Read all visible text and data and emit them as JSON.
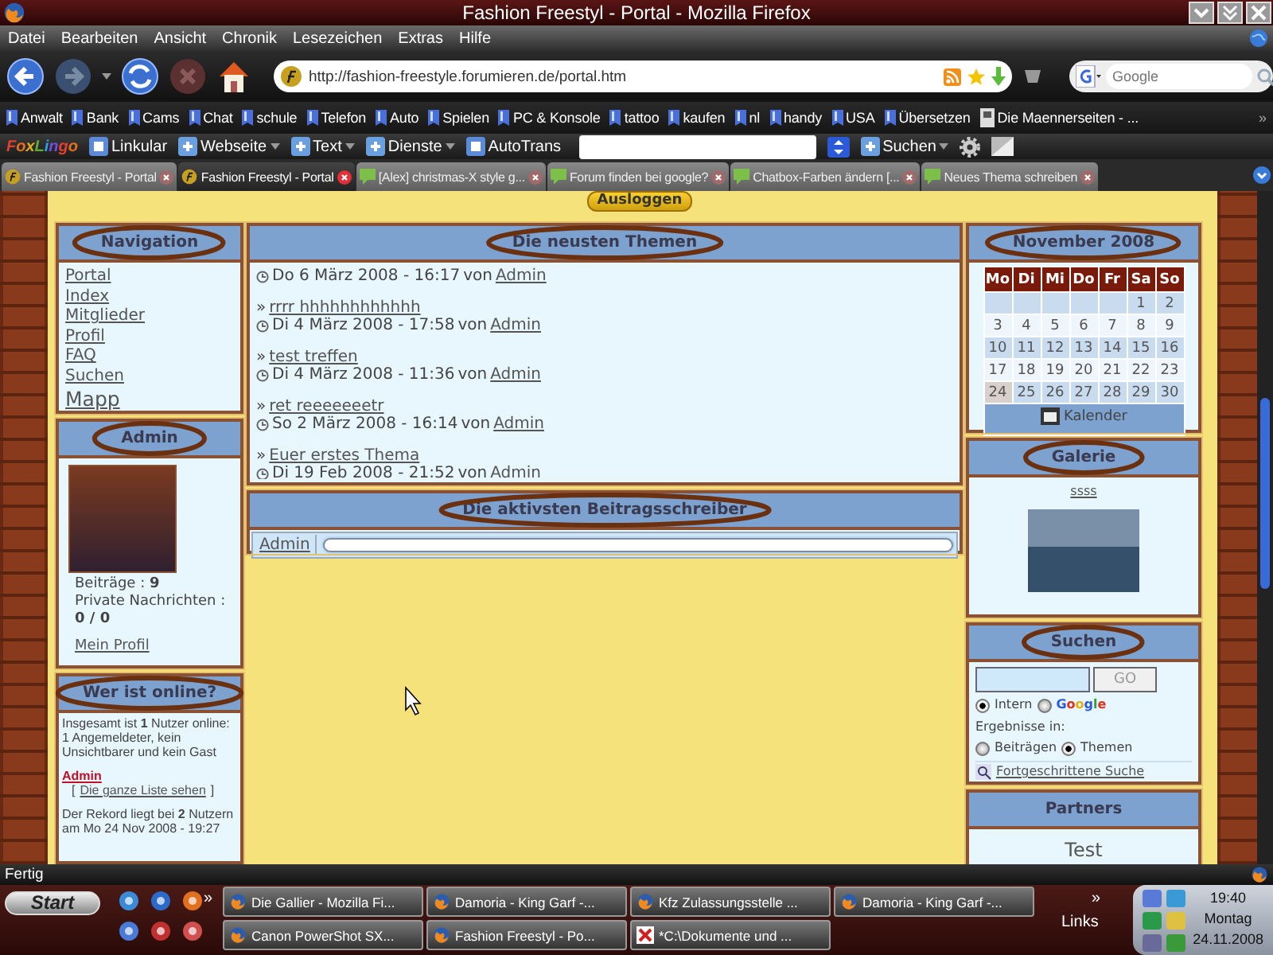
{
  "window": {
    "title": "Fashion Freestyl - Portal - Mozilla Firefox"
  },
  "menu": [
    "Datei",
    "Bearbeiten",
    "Ansicht",
    "Chronik",
    "Lesezeichen",
    "Extras",
    "Hilfe"
  ],
  "navigation_bar": {
    "url": "http://fashion-freestyle.forumieren.de/portal.htm",
    "search_placeholder": "Google"
  },
  "bookmarks": [
    "Anwalt",
    "Bank",
    "Cams",
    "Chat",
    "schule",
    "Telefon",
    "Auto",
    "Spielen",
    "PC & Konsole",
    "tattoo",
    "kaufen",
    "nl",
    "handy",
    "USA",
    "Übersetzen",
    "Die Maennerseiten - ..."
  ],
  "bookmarks_more": "»",
  "toolbar": [
    {
      "kind": "logo",
      "label": "FoxLingo"
    },
    {
      "kind": "button",
      "label": "Linkular"
    },
    {
      "kind": "menu",
      "label": "Webseite"
    },
    {
      "kind": "menu",
      "label": "Text"
    },
    {
      "kind": "menu",
      "label": "Dienste"
    },
    {
      "kind": "button",
      "label": "AutoTrans"
    },
    {
      "kind": "field"
    },
    {
      "kind": "menu",
      "label": "Suchen"
    },
    {
      "kind": "gear"
    }
  ],
  "tabs": [
    {
      "label": "Fashion Freestyl - Portal",
      "kind": "site",
      "selected": false
    },
    {
      "label": "Fashion Freestyl - Portal",
      "kind": "site",
      "selected": true
    },
    {
      "label": "[Alex] christmas-X style g...",
      "kind": "forum",
      "selected": false
    },
    {
      "label": "Forum finden bei google?",
      "kind": "forum",
      "selected": false
    },
    {
      "label": "Chatbox-Farben ändern [...",
      "kind": "forum",
      "selected": false
    },
    {
      "label": "Neues Thema schreiben",
      "kind": "forum",
      "selected": false
    }
  ],
  "logout_button": "Ausloggen",
  "sidebar_left": {
    "navigation": {
      "title": "Navigation",
      "circled": true,
      "links": [
        "Portal",
        "Index",
        "Mitglieder",
        "Profil",
        "FAQ",
        "Suchen",
        "Mapp"
      ]
    },
    "user": {
      "title": "Admin",
      "circled": true,
      "posts": "Beiträge : **9**",
      "messages_label": "Private Nachrichten :",
      "messages": "0 / 0",
      "profile_link": "Mein Profil"
    },
    "online": {
      "title": "Wer ist online?",
      "circled": true,
      "summary": "Insgesamt ist **1** Nutzer online: 1 Angemeldeter, kein Unsichtbarer und kein Gast",
      "users": [
        "Admin"
      ],
      "list_link": {
        "open": "[",
        "label": "Die ganze Liste sehen",
        "close": "]"
      },
      "record": "Der Rekord liegt bei **2** Nutzern am Mo 24 Nov 2008 - 19:27"
    }
  },
  "center": {
    "latest_topics": {
      "title": "Die neusten Themen",
      "circled": true,
      "items": [
        {
          "date": "Do 6 März 2008 - 16:17",
          "by": "von",
          "author": "Admin"
        },
        {
          "marker": "»",
          "title": "rrrr hhhhhhhhhhhh",
          "date": "Di 4 März 2008 - 17:58",
          "by": "von",
          "author": "Admin"
        },
        {
          "marker": "»",
          "title": "test treffen",
          "date": "Di 4 März 2008 - 11:36",
          "by": "von",
          "author": "Admin"
        },
        {
          "marker": "»",
          "title": "ret reeeeeeetr",
          "date": "So 2 März 2008 - 16:14",
          "by": "von",
          "author": "Admin"
        },
        {
          "marker": "»",
          "title": "Euer erstes Thema",
          "date": "Di 19 Feb 2008 - 21:52",
          "by": "von",
          "author": "Admin"
        }
      ]
    },
    "top_posters": {
      "title": "Die aktivsten Beitragsschreiber",
      "circled": true,
      "rows": [
        {
          "name": "Admin",
          "level": 1
        }
      ]
    }
  },
  "sidebar_right": {
    "calendar": {
      "title": "November 2008",
      "circled": true,
      "weekdays": [
        "Mo",
        "Di",
        "Mi",
        "Do",
        "Fr",
        "Sa",
        "So"
      ],
      "weeks": [
        [
          {
            "day": "1",
            "selected": false
          },
          {
            "day": "2",
            "selected": false
          }
        ],
        [
          {
            "day": "3",
            "selected": false
          },
          {
            "day": "4",
            "selected": false
          },
          {
            "day": "5",
            "selected": false
          },
          {
            "day": "6",
            "selected": false
          },
          {
            "day": "7",
            "selected": false
          },
          {
            "day": "8",
            "selected": false
          },
          {
            "day": "9",
            "selected": false
          }
        ],
        [
          {
            "day": "10",
            "selected": false
          },
          {
            "day": "11",
            "selected": false
          },
          {
            "day": "12",
            "selected": false
          },
          {
            "day": "13",
            "selected": false
          },
          {
            "day": "14",
            "selected": false
          },
          {
            "day": "15",
            "selected": false
          },
          {
            "day": "16",
            "selected": false
          }
        ],
        [
          {
            "day": "17",
            "selected": false
          },
          {
            "day": "18",
            "selected": false
          },
          {
            "day": "19",
            "selected": false
          },
          {
            "day": "20",
            "selected": false
          },
          {
            "day": "21",
            "selected": false
          },
          {
            "day": "22",
            "selected": false
          },
          {
            "day": "23",
            "selected": false
          }
        ],
        [
          {
            "day": "24",
            "selected": true
          },
          {
            "day": "25",
            "selected": false
          },
          {
            "day": "26",
            "selected": false
          },
          {
            "day": "27",
            "selected": false
          },
          {
            "day": "28",
            "selected": false
          },
          {
            "day": "29",
            "selected": false
          },
          {
            "day": "30",
            "selected": false
          }
        ]
      ],
      "footer": "Kalender"
    },
    "gallery": {
      "title": "Galerie",
      "circled": true,
      "caption": "ssss"
    },
    "search": {
      "title": "Suchen",
      "circled": true,
      "button": "GO",
      "scopes": [
        {
          "label": "Intern",
          "selected": true
        },
        {
          "label": "Google",
          "selected": false
        }
      ],
      "results_label": "Ergebnisse in:",
      "result_types": [
        {
          "label": "Beiträgen",
          "selected": false
        },
        {
          "label": "Themen",
          "selected": true
        }
      ],
      "advanced_link": "Fortgeschrittene Suche"
    },
    "partners": {
      "title": "Partners",
      "circled": false,
      "items": [
        "Test"
      ]
    }
  },
  "status_bar": {
    "text": "Fertig"
  },
  "taskbar": {
    "start": "Start",
    "quick_launch_more": "»",
    "tasks": [
      {
        "label": "Die Gallier - Mozilla Fi...",
        "kind": "firefox"
      },
      {
        "label": "Damoria - King Garf -...",
        "kind": "firefox"
      },
      {
        "label": "Kfz Zulassungsstelle ...",
        "kind": "firefox"
      },
      {
        "label": "Damoria - King Garf -...",
        "kind": "firefox"
      },
      {
        "label": "Canon PowerShot SX...",
        "kind": "firefox"
      },
      {
        "label": "Fashion Freestyl - Po...",
        "kind": "firefox"
      },
      {
        "label": "*C:\\Dokumente und ...",
        "kind": "editor"
      }
    ],
    "links_more": "»",
    "links": "Links",
    "clock": {
      "time": "19:40",
      "day": "Montag",
      "date": "24.11.2008"
    }
  }
}
